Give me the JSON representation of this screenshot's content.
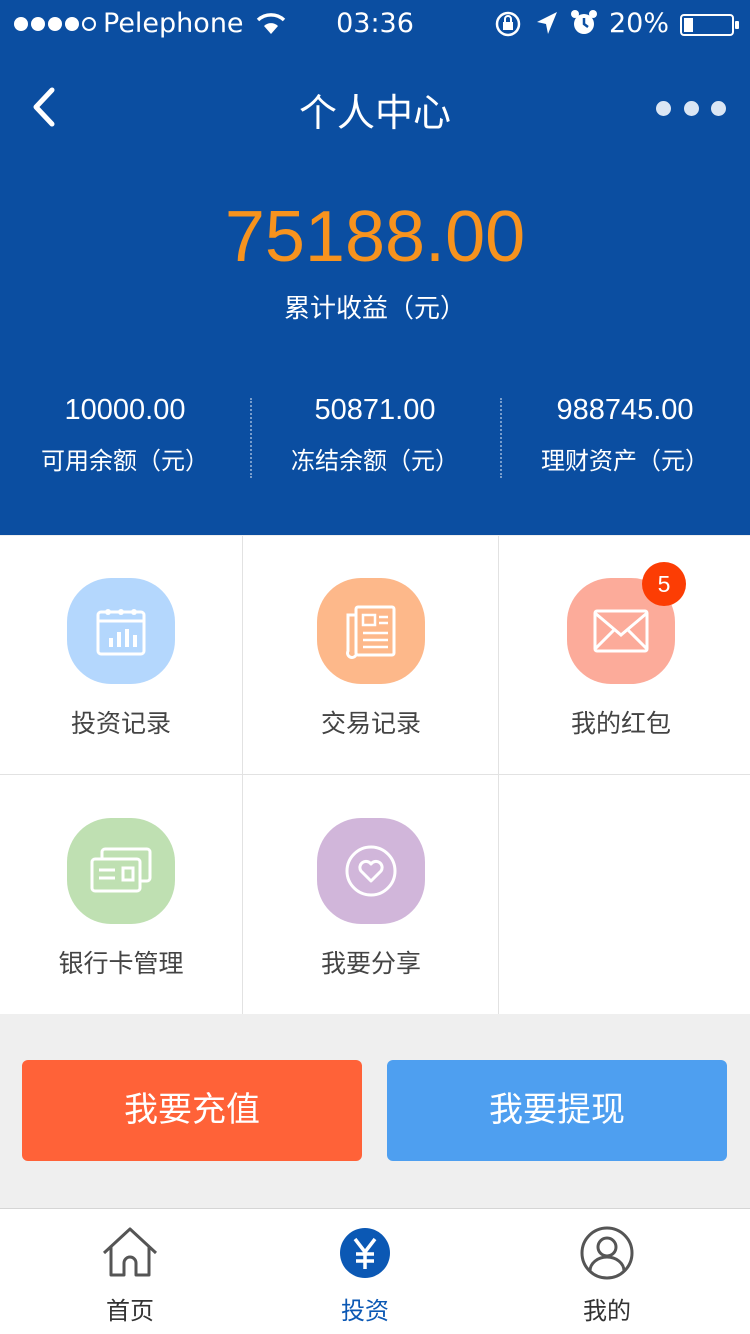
{
  "status_bar": {
    "carrier": "Pelephone",
    "time": "03:36",
    "battery": "20%",
    "signal_bars_filled": 4,
    "signal_bars_total": 5
  },
  "nav": {
    "title": "个人中心",
    "back_icon": "chevron-left-icon",
    "more_icon": "more-dots-icon"
  },
  "summary": {
    "total_income": "75188.00",
    "total_income_label": "累计收益（元）",
    "stats": [
      {
        "value": "10000.00",
        "label": "可用余额（元）"
      },
      {
        "value": "50871.00",
        "label": "冻结余额（元）"
      },
      {
        "value": "988745.00",
        "label": "理财资产（元）"
      }
    ]
  },
  "menu": [
    {
      "label": "投资记录",
      "icon": "calendar-chart-icon",
      "color": "#b4d7fd"
    },
    {
      "label": "交易记录",
      "icon": "document-list-icon",
      "color": "#fdb88a"
    },
    {
      "label": "我的红包",
      "icon": "envelope-icon",
      "color": "#fcab9a",
      "badge": "5"
    },
    {
      "label": "银行卡管理",
      "icon": "bank-card-icon",
      "color": "#bfe0b2"
    },
    {
      "label": "我要分享",
      "icon": "heart-circle-icon",
      "color": "#d1b6da"
    }
  ],
  "actions": {
    "recharge": "我要充值",
    "withdraw": "我要提现"
  },
  "tabs": [
    {
      "label": "首页",
      "icon": "home-icon",
      "active": false
    },
    {
      "label": "投资",
      "icon": "yuan-icon",
      "active": true
    },
    {
      "label": "我的",
      "icon": "user-circle-icon",
      "active": false
    }
  ],
  "colors": {
    "header_bg": "#0b4ea1",
    "accent_orange": "#f7931e",
    "recharge_btn": "#ff6238",
    "withdraw_btn": "#4e9ff0",
    "badge": "#fc3d04",
    "active_tab": "#0b58b4"
  }
}
